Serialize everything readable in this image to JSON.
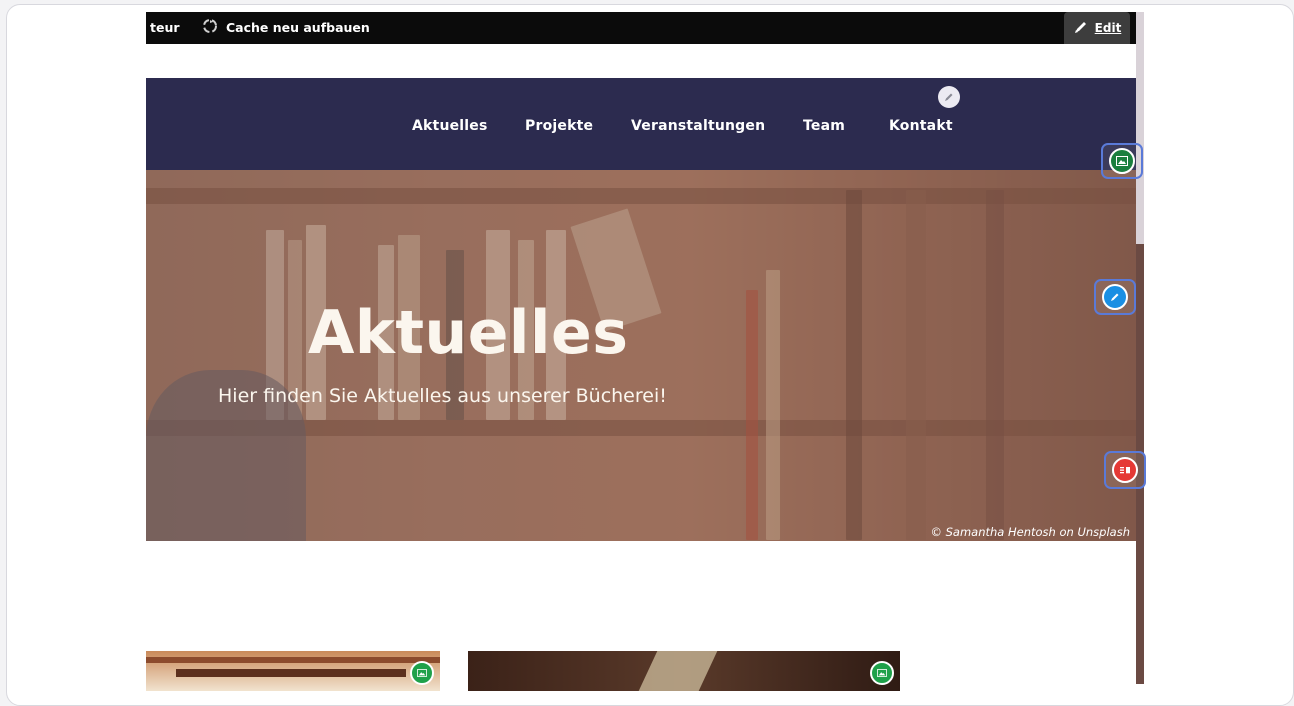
{
  "toolbar": {
    "partial_label": "teur",
    "cache_label": "Cache neu aufbauen",
    "edit_label": "Edit"
  },
  "nav": {
    "items": [
      {
        "label": "Aktuelles"
      },
      {
        "label": "Projekte"
      },
      {
        "label": "Veranstaltungen"
      },
      {
        "label": "Team"
      },
      {
        "label": "Kontakt"
      }
    ]
  },
  "hero": {
    "title": "Aktuelles",
    "subtitle": "Hier finden Sie Aktuelles aus unserer Bücherei!",
    "credit": "© Samantha Hentosh on Unsplash"
  },
  "icons": {
    "recycle": "recycle-icon",
    "pencil": "pencil-icon",
    "image": "image-icon",
    "layout": "layout-icon"
  },
  "colors": {
    "nav_bg": "#2c2b4f",
    "toolbar_bg": "#0b0b0b",
    "control_border": "#5a7ad8",
    "green_badge": "#1ea14a",
    "blue_badge": "#1a8fe3",
    "red_badge": "#e53935"
  }
}
